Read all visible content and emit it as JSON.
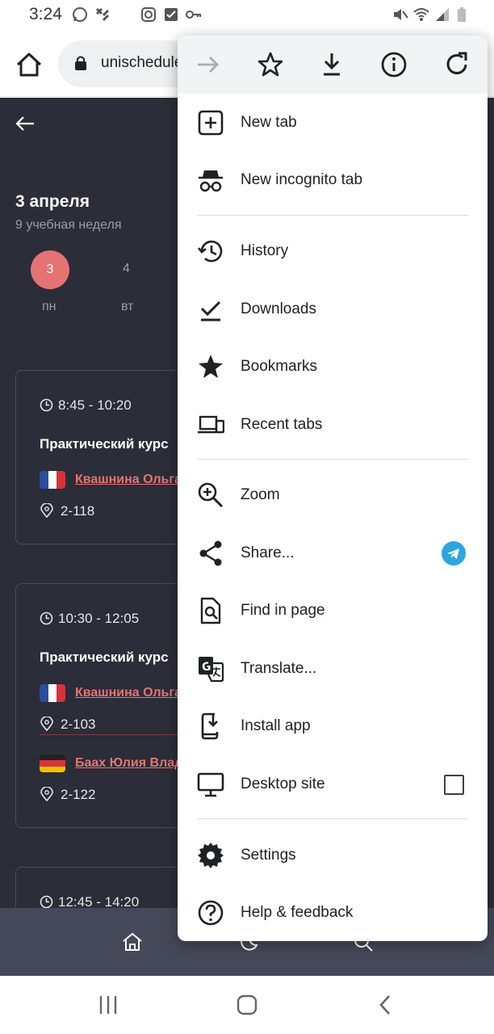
{
  "status_bar": {
    "time": "3:24"
  },
  "browser": {
    "url": "unischedule"
  },
  "page": {
    "date_title": "3 апреля",
    "week_label": "9 учебная неделя",
    "days": [
      {
        "num": "3",
        "name": "пн"
      },
      {
        "num": "4",
        "name": "вт"
      }
    ],
    "cards": [
      {
        "time": "8:45 - 10:20",
        "title": "Практический курс",
        "teachers": [
          {
            "name": "Квашнина Ольга",
            "room": "2-118"
          }
        ]
      },
      {
        "time": "10:30 - 12:05",
        "title": "Практический курс",
        "teachers": [
          {
            "name": "Квашнина Ольга",
            "room": "2-103"
          },
          {
            "name": "Баах Юлия Влад",
            "room": "2-122"
          }
        ]
      },
      {
        "time": "12:45 - 14:20"
      }
    ]
  },
  "menu": {
    "items": [
      {
        "label": "New tab"
      },
      {
        "label": "New incognito tab"
      },
      {
        "label": "History"
      },
      {
        "label": "Downloads"
      },
      {
        "label": "Bookmarks"
      },
      {
        "label": "Recent tabs"
      },
      {
        "label": "Zoom"
      },
      {
        "label": "Share..."
      },
      {
        "label": "Find in page"
      },
      {
        "label": "Translate..."
      },
      {
        "label": "Install app"
      },
      {
        "label": "Desktop site"
      },
      {
        "label": "Settings"
      },
      {
        "label": "Help & feedback"
      }
    ]
  },
  "colors": {
    "accent_red": "#e57373",
    "page_bg": "#2b2d38",
    "telegram_blue": "#2ca5e0"
  }
}
